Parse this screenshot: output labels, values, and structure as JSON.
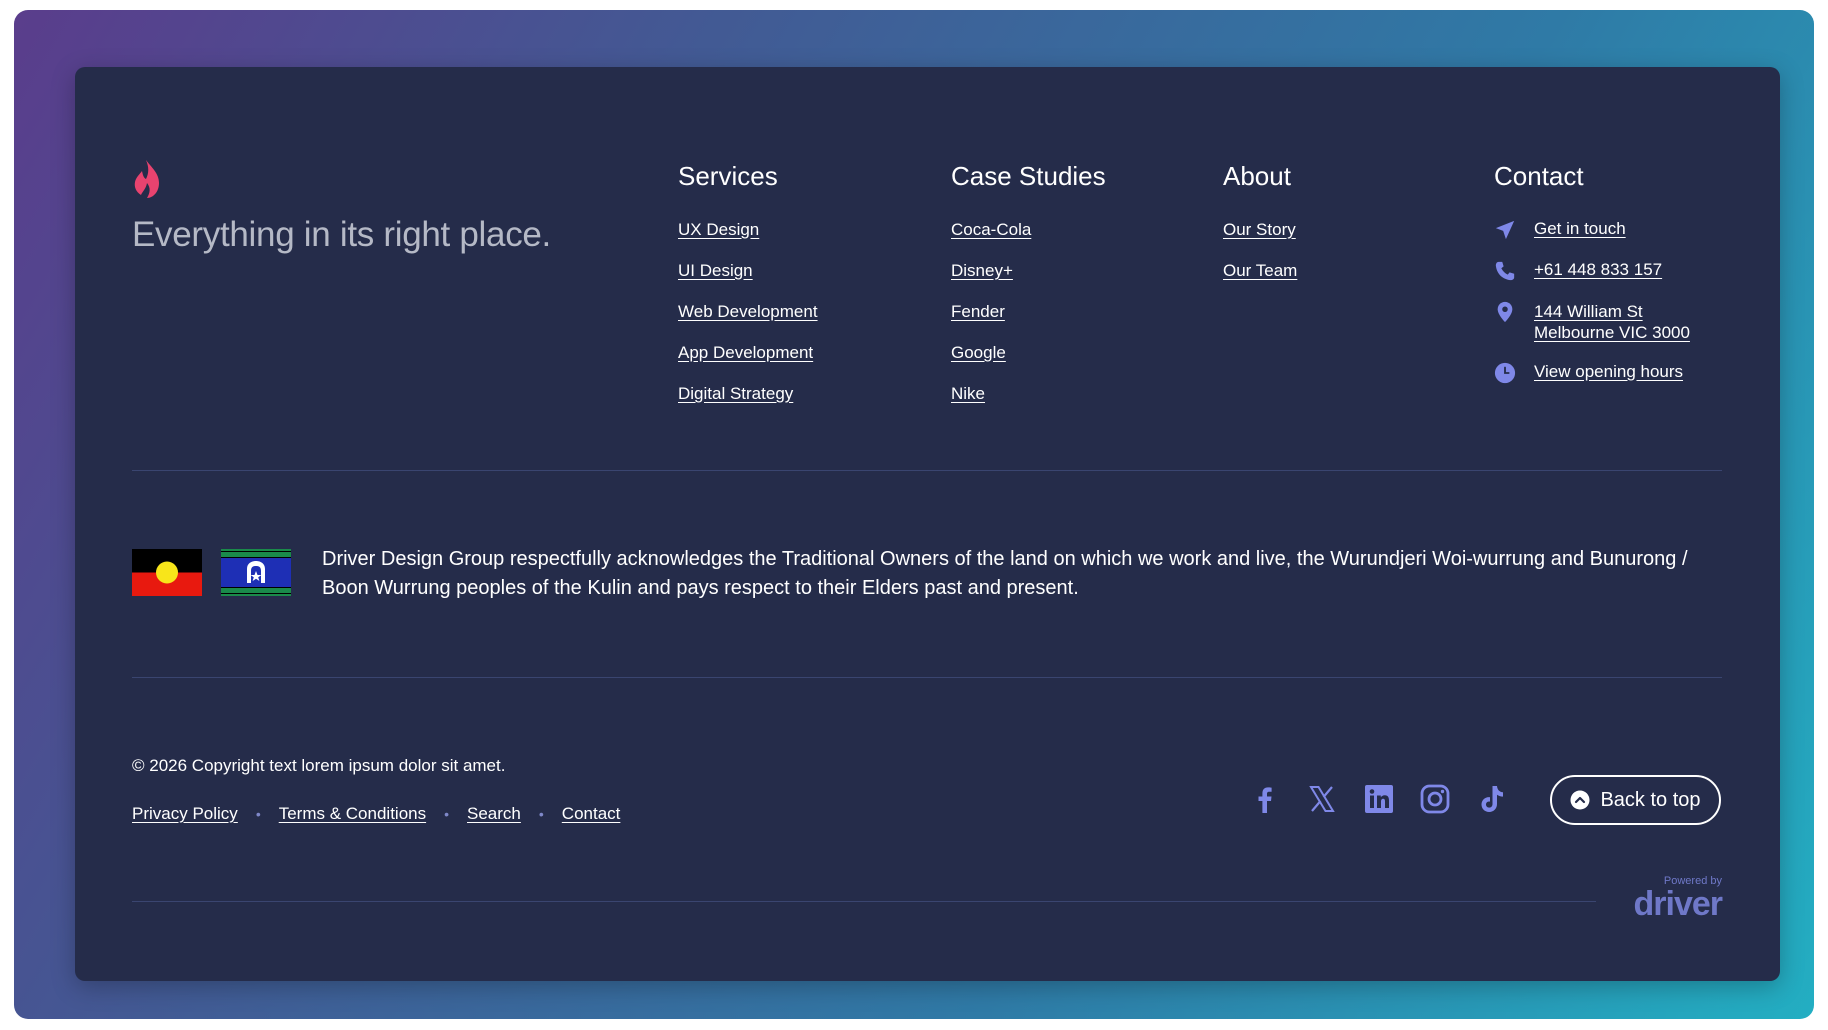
{
  "brand": {
    "tagline": "Everything in its right place."
  },
  "columns": {
    "services": {
      "title": "Services",
      "links": [
        "UX Design",
        "UI Design",
        "Web Development",
        "App Development",
        "Digital Strategy"
      ]
    },
    "case_studies": {
      "title": "Case Studies",
      "links": [
        "Coca-Cola",
        "Disney+",
        "Fender",
        "Google",
        "Nike"
      ]
    },
    "about": {
      "title": "About",
      "links": [
        "Our Story",
        "Our Team"
      ]
    },
    "contact": {
      "title": "Contact",
      "get_in_touch": "Get in touch",
      "phone": "+61 448 833 157",
      "address_line1": "144 William St",
      "address_line2": "Melbourne VIC 3000",
      "hours": "View opening hours"
    }
  },
  "acknowledgement": "Driver Design Group respectfully acknowledges the Traditional Owners of the land on which we work and live, the Wurundjeri Woi-wurrung and Bunurong / Boon Wurrung peoples of the Kulin and pays respect to their Elders past and present.",
  "footer": {
    "copyright": "© 2026 Copyright text lorem ipsum dolor sit amet.",
    "legal_links": [
      "Privacy Policy",
      "Terms & Conditions",
      "Search",
      "Contact"
    ],
    "back_to_top": "Back to top",
    "powered_by_label": "Powered by",
    "powered_by_brand": "driver"
  },
  "social": [
    "facebook-icon",
    "x-icon",
    "linkedin-icon",
    "instagram-icon",
    "tiktok-icon"
  ],
  "colors": {
    "panel_bg": "#252c4a",
    "accent": "#7f88e8",
    "flame": "#e8436f",
    "divider": "#3a4570",
    "tagline": "#b5b9c6"
  }
}
